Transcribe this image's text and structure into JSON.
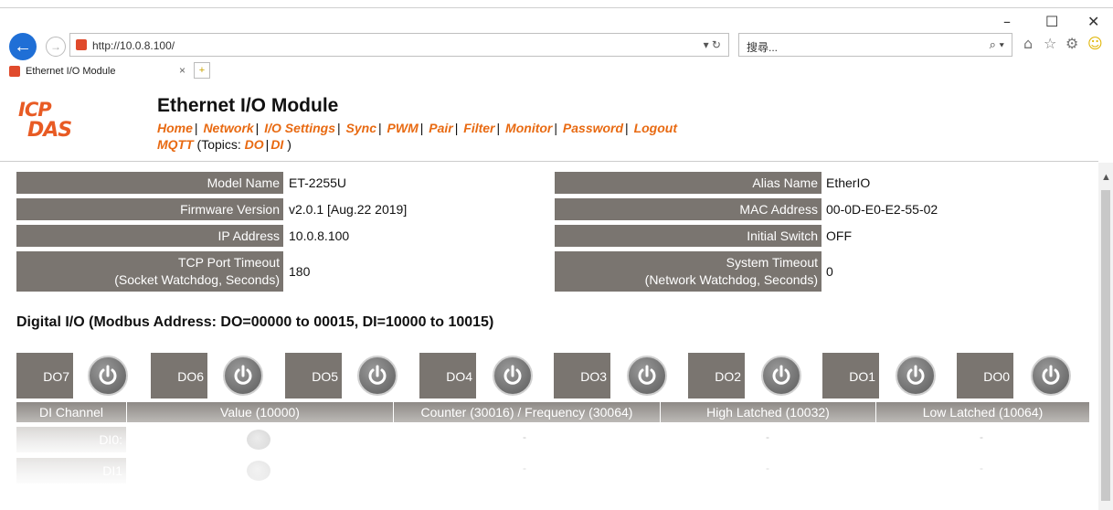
{
  "browser": {
    "url": "http://10.0.8.100/",
    "search_placeholder": "搜尋...",
    "tab_title": "Ethernet I/O Module",
    "minimize": "–",
    "maximize": "☐",
    "close": "✕"
  },
  "header": {
    "logo_line1": "ICP",
    "logo_line2": "DAS",
    "title": "Ethernet I/O Module",
    "nav": [
      "Home",
      "Network",
      "I/O Settings",
      "Sync",
      "PWM",
      "Pair",
      "Filter",
      "Monitor",
      "Password",
      "Logout"
    ],
    "mqtt_label": "MQTT",
    "topics_prefix": "(Topics: ",
    "topic_do": "DO",
    "topic_di": "DI",
    "topics_suffix": " )"
  },
  "info": {
    "model_name_label": "Model Name",
    "model_name": "ET-2255U",
    "alias_name_label": "Alias Name",
    "alias_name": "EtherIO",
    "firmware_label": "Firmware Version",
    "firmware": "v2.0.1 [Aug.22 2019]",
    "mac_label": "MAC Address",
    "mac": "00-0D-E0-E2-55-02",
    "ip_label": "IP Address",
    "ip": "10.0.8.100",
    "initial_switch_label": "Initial Switch",
    "initial_switch": "OFF",
    "tcp_timeout_label_1": "TCP Port Timeout",
    "tcp_timeout_label_2": "(Socket Watchdog, Seconds)",
    "tcp_timeout": "180",
    "sys_timeout_label_1": "System Timeout",
    "sys_timeout_label_2": "(Network Watchdog, Seconds)",
    "sys_timeout": "0"
  },
  "dio": {
    "title": "Digital I/O (Modbus Address: DO=00000 to 00015, DI=10000 to 10015)",
    "do_channels": [
      "DO7",
      "DO6",
      "DO5",
      "DO4",
      "DO3",
      "DO2",
      "DO1",
      "DO0"
    ],
    "di_headers": [
      "DI Channel",
      "Value (10000)",
      "Counter (30016) / Frequency (30064)",
      "High Latched (10032)",
      "Low Latched (10064)"
    ],
    "di_rows": [
      {
        "channel": "DI0:",
        "counter": "-",
        "high": "-",
        "low": "-"
      },
      {
        "channel": "DI1",
        "counter": "-",
        "high": "-",
        "low": "-"
      }
    ]
  },
  "colors": {
    "label_bg": "#7a7570",
    "link": "#e86a12",
    "logo": "#e85b24",
    "back_button": "#1f6fd6"
  }
}
